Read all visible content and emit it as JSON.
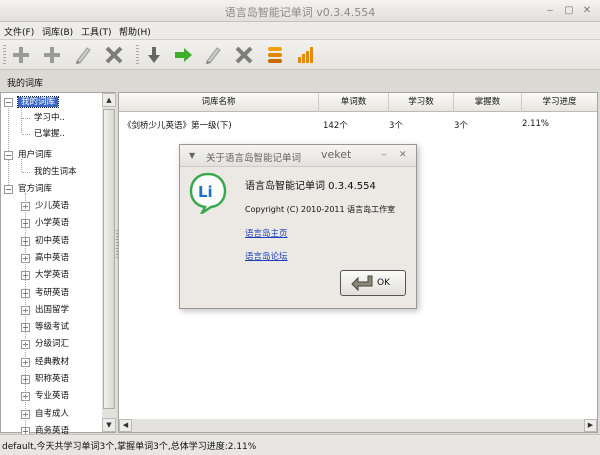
{
  "window": {
    "title": "语言岛智能记单词 v0.3.4.554",
    "controls": [
      "minimize-icon",
      "maximize-icon",
      "close-icon"
    ]
  },
  "menu": [
    "文件(F)",
    "词库(B)",
    "工具(T)",
    "帮助(H)"
  ],
  "toolbar": {
    "icons": [
      "add-icon",
      "add-icon",
      "edit-icon",
      "delete-icon",
      "down-arrow-icon",
      "right-arrow-icon",
      "edit-icon",
      "delete-icon",
      "stack-icon",
      "chart-icon"
    ]
  },
  "section_label": "我的词库",
  "tree": {
    "my_lib": "我的词库",
    "learning": "学习中..",
    "mastered": "已掌握..",
    "user_lib": "用户词库",
    "vocab_book": "我的生词本",
    "official_lib": "官方词库",
    "official_items": [
      "少儿英语",
      "小学英语",
      "初中英语",
      "高中英语",
      "大学英语",
      "考研英语",
      "出国留学",
      "等级考试",
      "分级词汇",
      "经典教材",
      "职称英语",
      "专业英语",
      "自考成人",
      "商务英语"
    ]
  },
  "table": {
    "columns": [
      "词库名称",
      "单词数",
      "学习数",
      "掌握数",
      "学习进度"
    ],
    "rows": [
      {
        "name": "《剑桥少儿英语》第一级(下)",
        "words": "142个",
        "learned": "3个",
        "mastered": "3个",
        "progress": "2.11%"
      }
    ]
  },
  "dialog": {
    "title": "关于语言岛智能记单词",
    "title_overlay": "veket",
    "app_name": "语言岛智能记单词 0.3.4.554",
    "copyright": "Copyright (C) 2010-2011 语言岛工作室",
    "link_home": "语言岛主页",
    "link_forum": "语言岛论坛",
    "ok": "OK",
    "logo_text": "Li"
  },
  "status": "default,今天共学习单词3个,掌握单词3个,总体学习进度:2.11%",
  "colors": {
    "selection": "#3b67c8",
    "link": "#1a3fb8",
    "logo_green": "#3aa84f"
  }
}
